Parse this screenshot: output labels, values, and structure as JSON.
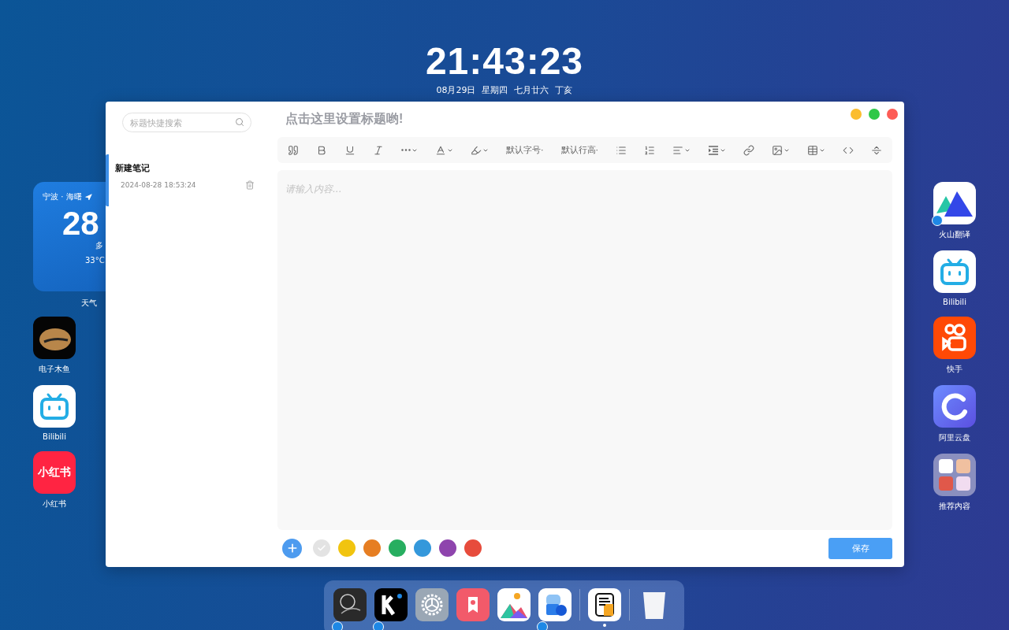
{
  "clock": {
    "time": "21:43:23",
    "date_parts": [
      "08月29日",
      "星期四",
      "七月廿六",
      "丁亥"
    ]
  },
  "weather": {
    "location": "宁波 · 海曙",
    "temperature": "28",
    "condition": "多",
    "range": "33°C",
    "label": "天气"
  },
  "left_apps": [
    {
      "label": "电子木鱼",
      "kind": "woodfish",
      "linked": false
    },
    {
      "label": "Bilibili",
      "kind": "tv",
      "linked": false
    },
    {
      "label": "小红书",
      "kind": "logo",
      "logo_text": "小红书",
      "linked": false
    }
  ],
  "right_apps": [
    {
      "label": "火山翻译",
      "kind": "translate",
      "linked": true
    },
    {
      "label": "Bilibili",
      "kind": "tv",
      "linked": false
    },
    {
      "label": "快手",
      "kind": "camera",
      "linked": false
    },
    {
      "label": "阿里云盘",
      "kind": "ring",
      "linked": false
    },
    {
      "label": "推荐内容",
      "kind": "folder",
      "linked": false
    }
  ],
  "window": {
    "title_placeholder": "点击这里设置标题哟!",
    "controls": [
      {
        "color": "#fbbd2e"
      },
      {
        "color": "#2ec848"
      },
      {
        "color": "#fd5c56"
      }
    ]
  },
  "sidebar": {
    "search": {
      "placeholder": "标题快捷搜索"
    },
    "notes": [
      {
        "title": "新建笔记",
        "time": "2024-08-28 18:53:24",
        "selected": true
      }
    ]
  },
  "toolbar": [
    {
      "kind": "quote",
      "caret": false
    },
    {
      "kind": "bold",
      "caret": false
    },
    {
      "kind": "underline",
      "caret": false
    },
    {
      "kind": "italic",
      "caret": false
    },
    {
      "kind": "more",
      "caret": true
    },
    {
      "kind": "font-color",
      "caret": true
    },
    {
      "kind": "back-color",
      "caret": true
    },
    {
      "kind": "text",
      "label": "默认字号·",
      "caret": false
    },
    {
      "kind": "text",
      "label": "默认行高·",
      "caret": false
    },
    {
      "kind": "bullet-list",
      "caret": false
    },
    {
      "kind": "numbered-list",
      "caret": false
    },
    {
      "kind": "align",
      "caret": true
    },
    {
      "kind": "indent",
      "caret": true
    },
    {
      "kind": "link",
      "caret": false
    },
    {
      "kind": "image",
      "caret": true
    },
    {
      "kind": "table",
      "caret": true
    },
    {
      "kind": "code",
      "caret": false
    },
    {
      "kind": "divider",
      "caret": false
    }
  ],
  "editor": {
    "placeholder": "请输入内容..."
  },
  "colors": [
    {
      "color": "#e3e3e3",
      "selected": true
    },
    {
      "color": "#f1c40f",
      "selected": false
    },
    {
      "color": "#e67e22",
      "selected": false
    },
    {
      "color": "#27ae60",
      "selected": false
    },
    {
      "color": "#3498db",
      "selected": false
    },
    {
      "color": "#8e44ad",
      "selected": false
    },
    {
      "color": "#e74c3c",
      "selected": false
    }
  ],
  "save_button": "保存",
  "dock": [
    {
      "kind": "sketch",
      "linked": true,
      "running": false
    },
    {
      "kind": "k",
      "linked": true,
      "running": false
    },
    {
      "kind": "gear",
      "linked": false,
      "running": false
    },
    {
      "kind": "bookmark",
      "linked": false,
      "running": false
    },
    {
      "kind": "mountains",
      "linked": false,
      "running": false
    },
    {
      "kind": "blocks",
      "linked": true,
      "running": false
    },
    {
      "kind": "separator"
    },
    {
      "kind": "notepad",
      "linked": false,
      "running": true
    },
    {
      "kind": "separator"
    },
    {
      "kind": "trash",
      "linked": false,
      "running": false
    }
  ]
}
